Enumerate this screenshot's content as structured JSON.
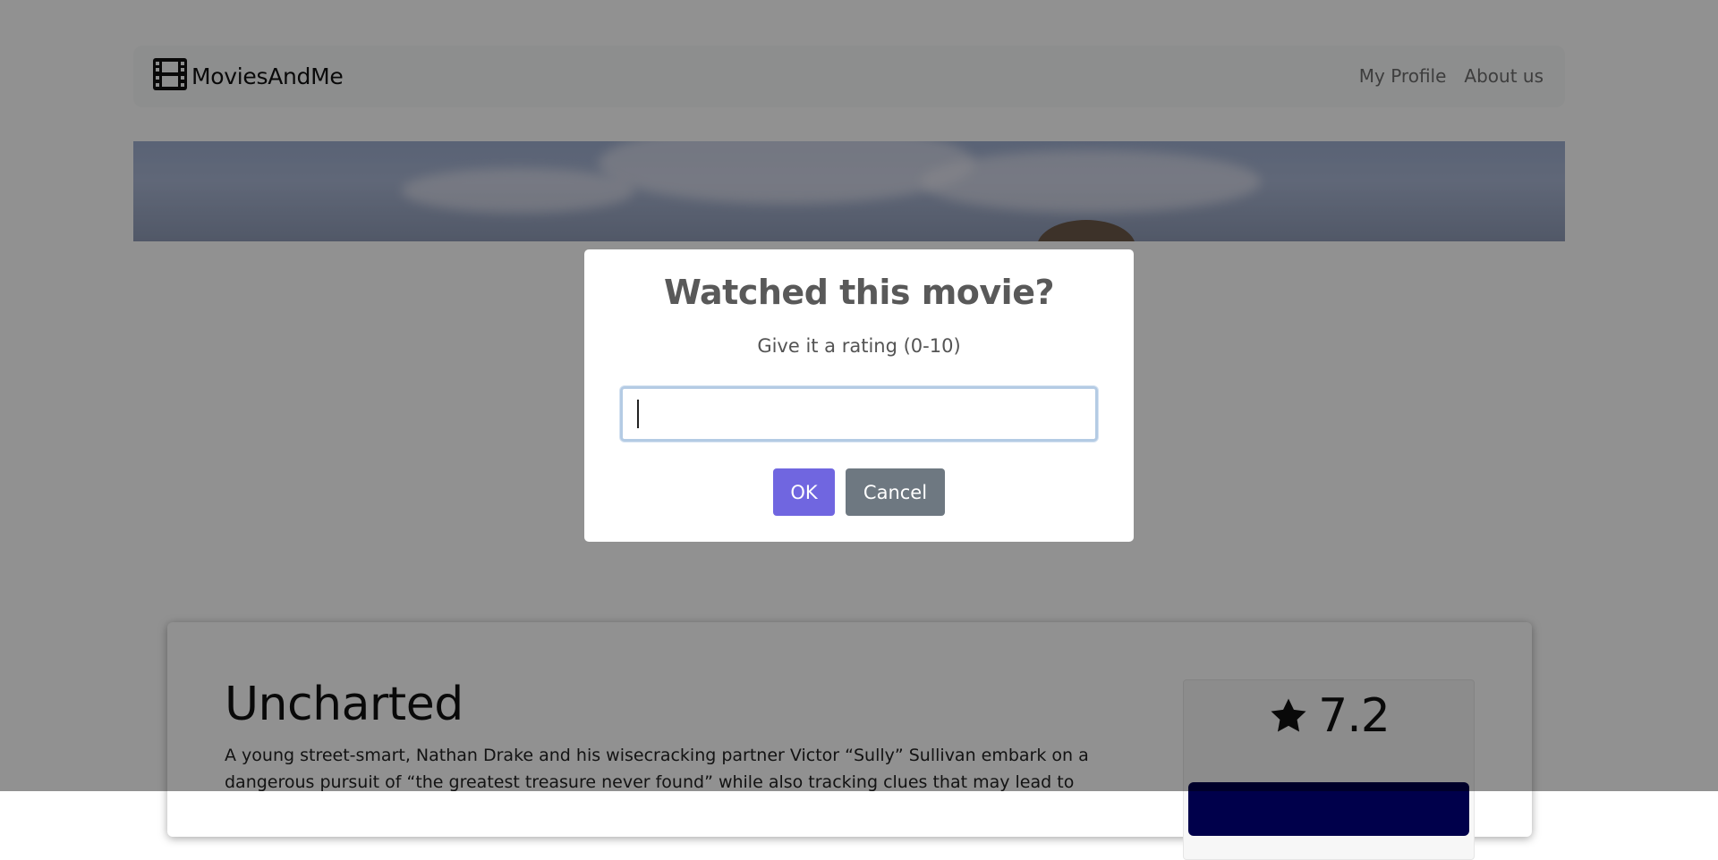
{
  "navbar": {
    "brand": "MoviesAndMe",
    "brand_icon": "film-icon",
    "links": [
      "My Profile",
      "About us"
    ]
  },
  "movie": {
    "title": "Uncharted",
    "description": "A young street-smart, Nathan Drake and his wisecracking partner Victor “Sully” Sullivan embark on a dangerous pursuit of “the greatest treasure never found” while also tracking clues that may lead to",
    "rating": "7.2",
    "rating_icon": "star-icon"
  },
  "modal": {
    "title": "Watched this movie?",
    "text": "Give it a rating (0-10)",
    "input_value": "",
    "ok_label": "OK",
    "cancel_label": "Cancel"
  },
  "colors": {
    "ok_button": "#7066e0",
    "cancel_button": "#6e7881",
    "overlay": "rgba(0,0,0,0.43)",
    "rating_button": "#00004b"
  }
}
